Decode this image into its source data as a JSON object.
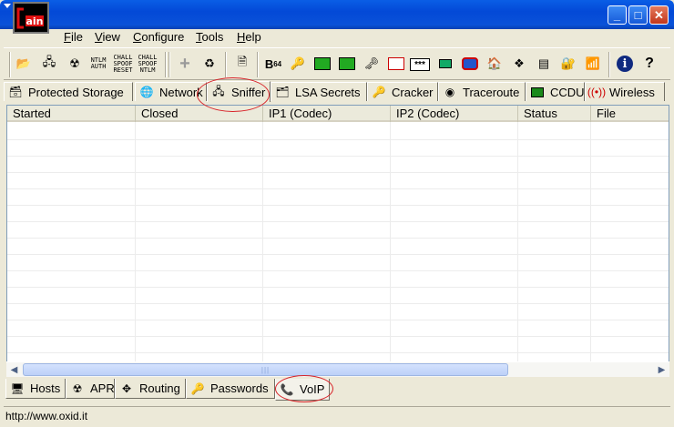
{
  "app": {
    "logo_text": "Cain",
    "window_controls": [
      "minimize-icon",
      "maximize-icon",
      "close-icon"
    ]
  },
  "menu": [
    "File",
    "View",
    "Configure",
    "Tools",
    "Help"
  ],
  "toolbar": {
    "icons": [
      "open-folder-icon",
      "sniffer-icon",
      "apr-poison-icon",
      "ntlm-auth-icon",
      "chall-spoof-reset-icon",
      "chall-spoof-ntlm-icon",
      "add-icon",
      "delete-icon",
      "hash-calc-icon",
      "base64-icon",
      "key-icon",
      "lm-hash-icon",
      "md5-hash-icon",
      "rsa-icon",
      "rc-icon",
      "password-box-icon",
      "lsa-icon",
      "vpn-icon",
      "access-icon",
      "network-icon",
      "cisco-icon",
      "box-icon",
      "wireless-icon",
      "info-icon",
      "help-icon"
    ],
    "labels": {
      "ntlm_auth": [
        "NTLM",
        "AUTH"
      ],
      "chall_reset": [
        "CHALL",
        "SPOOF",
        "RESET"
      ],
      "chall_ntlm": [
        "CHALL",
        "SPOOF",
        "NTLM"
      ],
      "b64": "B",
      "b64_sub": "64",
      "stars": "***"
    }
  },
  "top_tabs": [
    {
      "label": "Protected Storage",
      "icon": "protected-storage-icon"
    },
    {
      "label": "Network",
      "icon": "network-globe-icon"
    },
    {
      "label": "Sniffer",
      "icon": "sniffer-icon",
      "active": true
    },
    {
      "label": "LSA Secrets",
      "icon": "lsa-secrets-icon"
    },
    {
      "label": "Cracker",
      "icon": "cracker-key-icon"
    },
    {
      "label": "Traceroute",
      "icon": "traceroute-icon"
    },
    {
      "label": "CCDU",
      "icon": "ccdu-icon"
    },
    {
      "label": "Wireless",
      "icon": "wireless-antenna-icon"
    }
  ],
  "table": {
    "columns": [
      "Started",
      "Closed",
      "IP1 (Codec)",
      "IP2 (Codec)",
      "Status",
      "File"
    ],
    "rows": []
  },
  "bottom_tabs": [
    {
      "label": "Hosts",
      "icon": "hosts-computer-icon"
    },
    {
      "label": "APR",
      "icon": "apr-radiation-icon"
    },
    {
      "label": "Routing",
      "icon": "routing-arrows-icon"
    },
    {
      "label": "Passwords",
      "icon": "passwords-key-icon"
    },
    {
      "label": "VoIP",
      "icon": "voip-icon",
      "active": true
    }
  ],
  "status": {
    "url": "http://www.oxid.it"
  },
  "colors": {
    "title_bar": "#0349d7",
    "annotation": "#d8242a",
    "window_bg": "#ece9d8"
  }
}
